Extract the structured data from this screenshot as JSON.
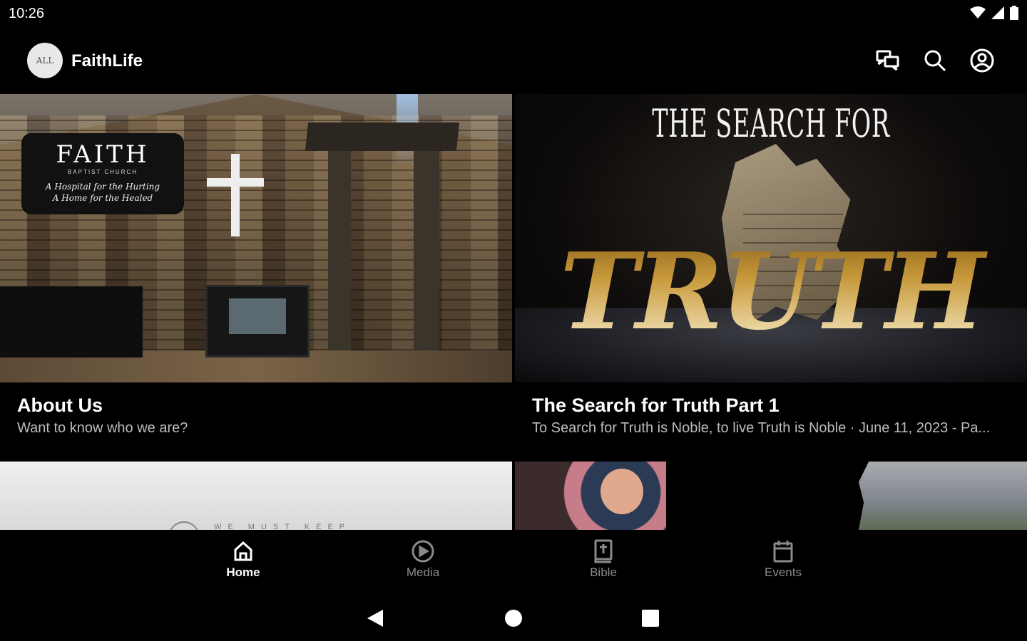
{
  "status": {
    "time": "10:26"
  },
  "app": {
    "title": "FaithLife",
    "logo_text": "ALL"
  },
  "actions": [
    {
      "name": "chat-icon"
    },
    {
      "name": "search-icon"
    },
    {
      "name": "account-icon"
    }
  ],
  "cards": [
    {
      "title": "About Us",
      "subtitle": "Want to know who we are?",
      "image": {
        "sign_title": "FAITH",
        "sign_sub": "BAPTIST CHURCH",
        "sign_line1": "A Hospital for the Hurting",
        "sign_line2": "A Home for the Healed"
      }
    },
    {
      "title": "The Search for Truth Part 1",
      "subtitle": "To Search for Truth is Noble, to live Truth is Noble · June 11, 2023 - Pa...",
      "image": {
        "top_text": "THE SEARCH FOR",
        "main_text": "TRUTH"
      }
    }
  ],
  "row2": [
    {
      "caption": "WE MUST KEEP"
    },
    {
      "caption": ""
    }
  ],
  "tabs": [
    {
      "label": "Home",
      "icon": "home-icon",
      "active": true
    },
    {
      "label": "Media",
      "icon": "play-circle-icon",
      "active": false
    },
    {
      "label": "Bible",
      "icon": "bible-icon",
      "active": false
    },
    {
      "label": "Events",
      "icon": "calendar-icon",
      "active": false
    }
  ],
  "colors": {
    "background": "#000000",
    "active_tab": "#ffffff",
    "inactive_tab": "#8a8a8a",
    "subtitle": "#bcbcbc"
  }
}
